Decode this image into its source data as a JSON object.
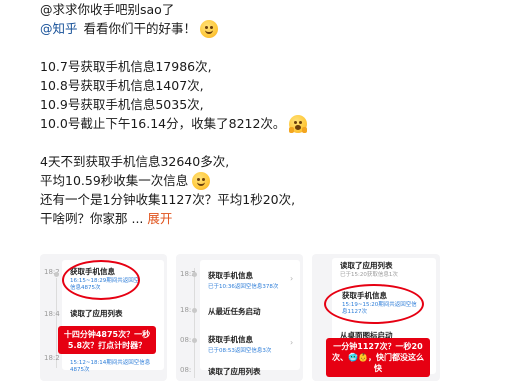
{
  "post": {
    "l1": "@求求你收手吧别sao了",
    "l2_mention": "@知乎",
    "l2_text": "看看你们干的好事！",
    "l3": "10.7号获取手机信息17986次,",
    "l4": "10.8号获取手机信息1407次,",
    "l5": "10.9号获取手机信息5035次,",
    "l6": "10.0号截止下午16.14分，收集了8212次。",
    "l7": "4天不到获取手机信息32640多次,",
    "l8": "平均10.59秒收集一次信息",
    "l9": "还有一个是1分钟收集1127次？平均1秒20次,",
    "l10": "干啥咧？你家那 ...",
    "more": "展开"
  },
  "icons": [
    "smile-emoji-icon",
    "shocked-emoji-icon",
    "chevron-right-icon"
  ],
  "colors": {
    "mention": "#175199",
    "expand": "#e0531c",
    "annotation": "#e60012",
    "link": "#2b7cd8"
  },
  "images": {
    "card1": {
      "side_a": "18:2",
      "title_a": "获取手机信息",
      "sub_a": "16:15~18:29期间共返回空信息4875次",
      "side_b": "18:4",
      "title_b": "读取了应用列表",
      "side_c": "18:2",
      "sub_c": "15:12~18:14期间共返回空信息4875次",
      "callout": "十四分钟4875次？一秒5.8次？打点计时器？"
    },
    "card2": {
      "side_a": "18:2",
      "title_a": "获取手机信息",
      "sub_a": "已于10:36返回空信息378次",
      "side_b": "18:",
      "title_b": "从最近任务启动",
      "side_c": "08:",
      "title_c": "获取手机信息",
      "sub_c": "已于08:53返回空信息3次",
      "side_d": "08:",
      "title_d": "读取了应用列表"
    },
    "card3": {
      "title_a": "读取了应用列表",
      "sub_a": "已于15:20获取信息1次",
      "title_b": "获取手机信息",
      "sub_b": "15:19~15:20期间共返回空信息1127次",
      "title_c": "从桌面图标启动",
      "callout": "一分钟1127次？一秒20次、🥶👶，快门都没这么快"
    }
  }
}
